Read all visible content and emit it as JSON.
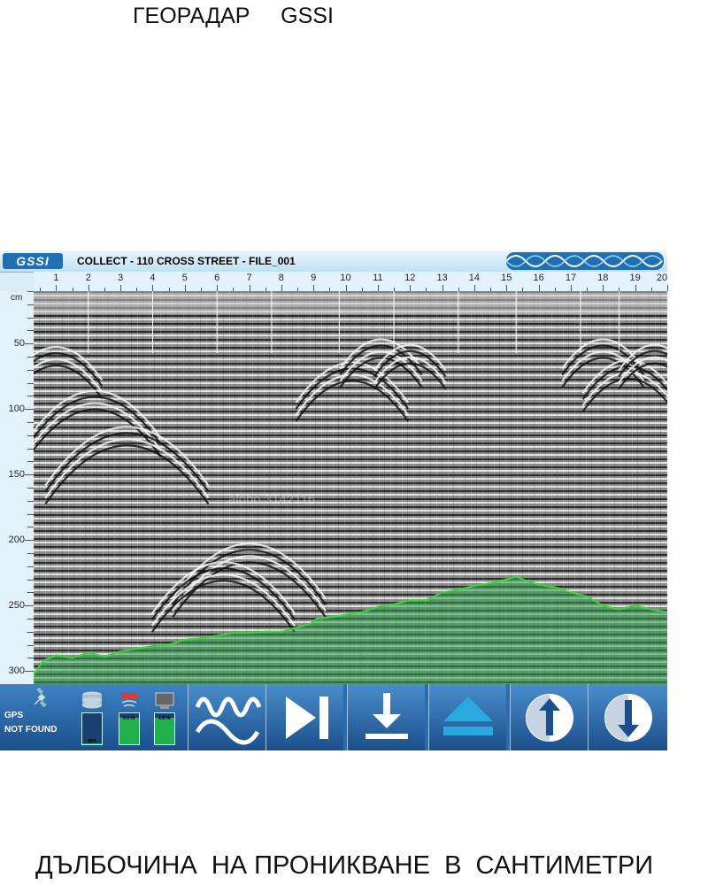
{
  "page": {
    "title": "ГЕОРАДАР     GSSI",
    "caption": "ДЪЛБОЧИНА  НА ПРОНИКВАНЕ  В  САНТИМЕТРИ"
  },
  "window": {
    "logo_text": "GSSI",
    "title": "COLLECT - 110 CROSS STREET - FILE_001"
  },
  "horizontal_scale": [
    "1",
    "2",
    "3",
    "4",
    "5",
    "6",
    "7",
    "8",
    "9",
    "10",
    "11",
    "12",
    "13",
    "14",
    "15",
    "16",
    "17",
    "18",
    "19",
    "20"
  ],
  "depth_scale": {
    "unit": "cm",
    "labels": [
      "50",
      "100",
      "150",
      "200",
      "250",
      "300"
    ]
  },
  "radargram": {
    "watermark": "alobo 3142116",
    "colors": {
      "trace_line": "#38d638",
      "fill": "#2fa24a"
    },
    "depth_profile_cm": [
      [
        0,
        310
      ],
      [
        0.3,
        303
      ],
      [
        0.6,
        292
      ],
      [
        1,
        288
      ],
      [
        1.5,
        290
      ],
      [
        2,
        286
      ],
      [
        2.5,
        289
      ],
      [
        3,
        285
      ],
      [
        3.5,
        283
      ],
      [
        4,
        281
      ],
      [
        4.5,
        280
      ],
      [
        5,
        276
      ],
      [
        5.5,
        275
      ],
      [
        6,
        273
      ],
      [
        6.5,
        271
      ],
      [
        7,
        271
      ],
      [
        7.5,
        270
      ],
      [
        8,
        270
      ],
      [
        8.3,
        268
      ],
      [
        8.6,
        266
      ],
      [
        8.9,
        264
      ],
      [
        9.1,
        260
      ],
      [
        9.5,
        259
      ],
      [
        10,
        257
      ],
      [
        10.5,
        255
      ],
      [
        11,
        251
      ],
      [
        11.5,
        249
      ],
      [
        12,
        246
      ],
      [
        12.5,
        246
      ],
      [
        13,
        240
      ],
      [
        13.5,
        238
      ],
      [
        14,
        235
      ],
      [
        14.5,
        233
      ],
      [
        15,
        230
      ],
      [
        15.3,
        228
      ],
      [
        15.6,
        231
      ],
      [
        16,
        234
      ],
      [
        16.5,
        236
      ],
      [
        17,
        240
      ],
      [
        17.5,
        243
      ],
      [
        18,
        250
      ],
      [
        18.5,
        253
      ],
      [
        19,
        250
      ],
      [
        19.5,
        253
      ],
      [
        20,
        255
      ]
    ]
  },
  "status": {
    "gps_label": "GPS",
    "gps_status": "NOT FOUND",
    "storage_percent": 99,
    "battery_levels": [
      85,
      85
    ],
    "storage_label": "99%",
    "battery_labels": [
      "9.0 Hr",
      "4.8 Hr"
    ]
  },
  "toolbar": {
    "buttons": [
      {
        "name": "wave-settings-button",
        "icon": "waveform-icon"
      },
      {
        "name": "play-next-button",
        "icon": "play-next-icon"
      },
      {
        "name": "save-button",
        "icon": "download-icon"
      },
      {
        "name": "eject-button",
        "icon": "eject-icon"
      },
      {
        "name": "scroll-up-button",
        "icon": "arrow-up-circle-icon"
      },
      {
        "name": "scroll-down-button",
        "icon": "arrow-down-circle-icon"
      }
    ]
  }
}
